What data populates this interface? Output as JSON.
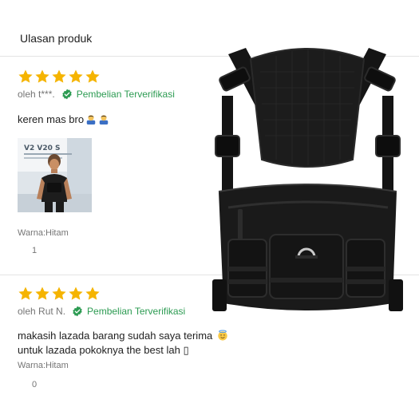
{
  "header": {
    "title": "Ulasan produk"
  },
  "reviews": [
    {
      "rating": 5,
      "author": "oleh t***.",
      "verified_label": "Pembelian Terverifikasi",
      "comment_text": "keren mas bro",
      "comment_emojis": [
        "man-bowing-emoji",
        "man-bowing-emoji"
      ],
      "photo_text": "V2 V20 S",
      "variant": "Warna:Hitam",
      "likes": "1"
    },
    {
      "rating": 5,
      "author": "oleh Rut N.",
      "verified_label": "Pembelian Terverifikasi",
      "comment_line1": "makasih lazada barang sudah saya terima",
      "comment_line1_emoji": "smiling-face-with-halo-emoji",
      "comment_line2": "untuk lazada pokoknya the best lah",
      "comment_line2_symbol": "▯",
      "variant": "Warna:Hitam",
      "likes": "0"
    }
  ],
  "colors": {
    "star": "#f5b400",
    "verified": "#2c9b52",
    "divider": "#e4e4e4",
    "secondary_text": "#757575"
  },
  "product_image": {
    "subject": "black chest rig bag"
  }
}
